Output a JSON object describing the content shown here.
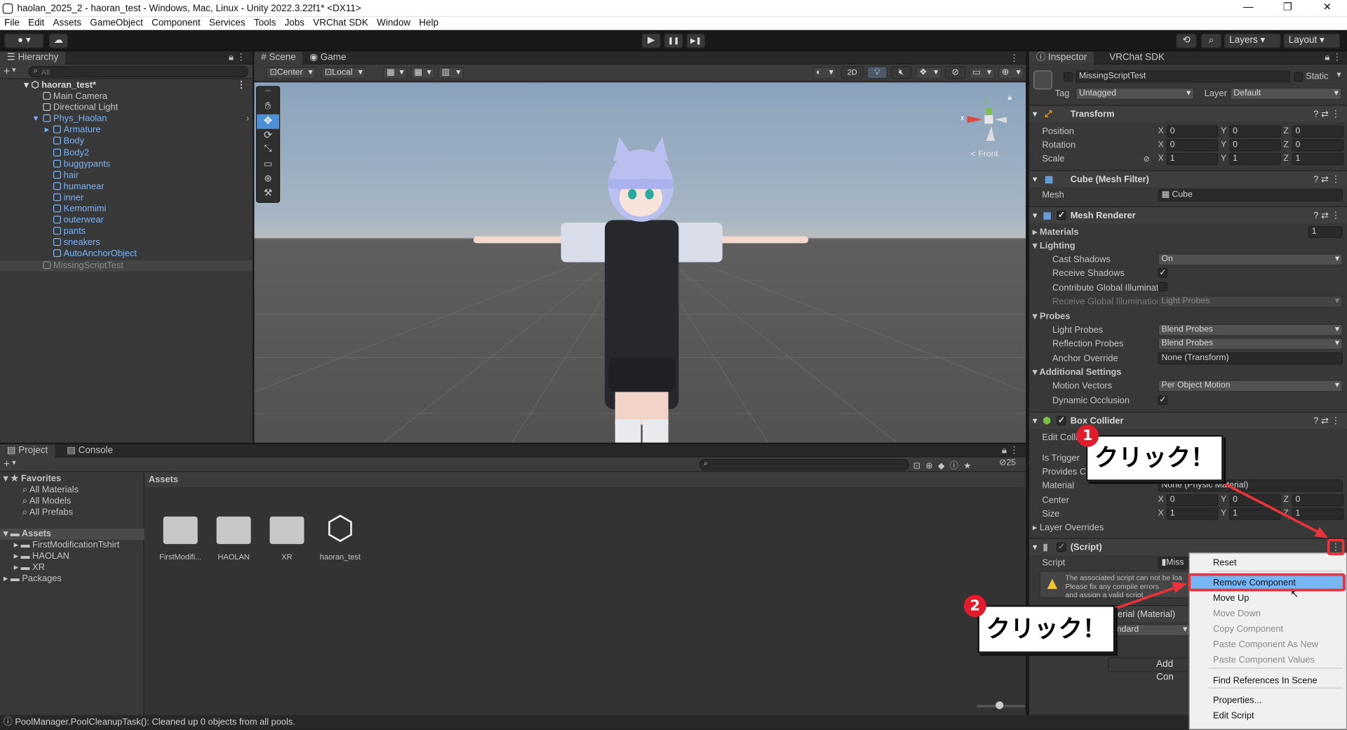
{
  "window": {
    "title": "haolan_2025_2 - haoran_test - Windows, Mac, Linux - Unity 2022.3.22f1* <DX11>",
    "min": "—",
    "max": "❐",
    "close": "✕"
  },
  "menu": [
    "File",
    "Edit",
    "Assets",
    "GameObject",
    "Component",
    "Services",
    "Tools",
    "Jobs",
    "VRChat SDK",
    "Window",
    "Help"
  ],
  "toolbar": {
    "play": "▶",
    "pause": "❚❚",
    "step": "▶❚",
    "layers": "Layers",
    "layout": "Layout"
  },
  "hierarchy": {
    "tab": "Hierarchy",
    "search_placeholder": "All",
    "add": "+",
    "scene": "haoran_test*",
    "items": [
      {
        "label": "Main Camera",
        "depth": 1,
        "color": "#c4c4c4"
      },
      {
        "label": "Directional Light",
        "depth": 1,
        "color": "#c4c4c4"
      },
      {
        "label": "Phys_Haolan",
        "depth": 1,
        "color": "#7cb4f7"
      },
      {
        "label": "Armature",
        "depth": 2,
        "color": "#7cb4f7"
      },
      {
        "label": "Body",
        "depth": 2,
        "color": "#7cb4f7"
      },
      {
        "label": "Body2",
        "depth": 2,
        "color": "#7cb4f7"
      },
      {
        "label": "buggypants",
        "depth": 2,
        "color": "#7cb4f7"
      },
      {
        "label": "hair",
        "depth": 2,
        "color": "#7cb4f7"
      },
      {
        "label": "humanear",
        "depth": 2,
        "color": "#7cb4f7"
      },
      {
        "label": "inner",
        "depth": 2,
        "color": "#7cb4f7"
      },
      {
        "label": "Kemomimi",
        "depth": 2,
        "color": "#7cb4f7"
      },
      {
        "label": "outerwear",
        "depth": 2,
        "color": "#7cb4f7"
      },
      {
        "label": "pants",
        "depth": 2,
        "color": "#7cb4f7"
      },
      {
        "label": "sneakers",
        "depth": 2,
        "color": "#7cb4f7"
      },
      {
        "label": "AutoAnchorObject",
        "depth": 2,
        "color": "#7cb4f7"
      },
      {
        "label": "MissingScriptTest",
        "depth": 1,
        "color": "#8a8a8a"
      }
    ]
  },
  "scene": {
    "tab_scene": "Scene",
    "tab_game": "Game",
    "pivot": "Center",
    "space": "Local",
    "mode2d": "2D",
    "gizmo_label": "< Front",
    "gizmo_x": "x",
    "gizmo_y": "y"
  },
  "inspector": {
    "tab": "Inspector",
    "tab2": "VRChat SDK",
    "object_name": "MissingScriptTest",
    "static": "Static",
    "tag_label": "Tag",
    "tag": "Untagged",
    "layer_label": "Layer",
    "layer": "Default",
    "transform": {
      "title": "Transform",
      "position": "Position",
      "rotation": "Rotation",
      "scale": "Scale",
      "pos": [
        "0",
        "0",
        "0"
      ],
      "rot": [
        "0",
        "0",
        "0"
      ],
      "scl": [
        "1",
        "1",
        "1"
      ]
    },
    "meshfilter": {
      "title": "Cube (Mesh Filter)",
      "mesh_label": "Mesh",
      "mesh": "Cube"
    },
    "meshrenderer": {
      "title": "Mesh Renderer",
      "materials": "Materials",
      "materials_count": "1",
      "lighting": "Lighting",
      "cast_shadows": "Cast Shadows",
      "cast_value": "On",
      "receive_shadows": "Receive Shadows",
      "contribute_gi": "Contribute Global Illuminat",
      "receive_gi": "Receive Global Illuminatior",
      "receive_gi_value": "Light Probes",
      "probes": "Probes",
      "light_probes": "Light Probes",
      "light_probes_value": "Blend Probes",
      "reflection_probes": "Reflection Probes",
      "reflection_value": "Blend Probes",
      "anchor": "Anchor Override",
      "anchor_value": "None (Transform)",
      "additional": "Additional Settings",
      "motion_vectors": "Motion Vectors",
      "motion_value": "Per Object Motion",
      "dynamic_occlusion": "Dynamic Occlusion"
    },
    "boxcollider": {
      "title": "Box Collider",
      "edit": "Edit Colli",
      "is_trigger": "Is Trigger",
      "provides": "Provides C",
      "material": "Material",
      "material_value": "None (Physic Material)",
      "center": "Center",
      "size": "Size",
      "center_v": [
        "0",
        "0",
        "0"
      ],
      "size_v": [
        "1",
        "1",
        "1"
      ],
      "layer_overrides": "Layer Overrides"
    },
    "script": {
      "title": "(Script)",
      "label": "Script",
      "value": "Miss",
      "warn1": "The associated script can not be loa",
      "warn2": "Please fix any compile errors",
      "warn3": "and assign a valid script"
    },
    "material_title": "terial (Material)",
    "shader": "ndard",
    "add_component": "Add Con"
  },
  "project": {
    "tab": "Project",
    "tab2": "Console",
    "add": "+",
    "count": "25",
    "favorites": "Favorites",
    "fav_items": [
      "All Materials",
      "All Models",
      "All Prefabs"
    ],
    "assets": "Assets",
    "asset_folders": [
      "FirstModificationTshirt",
      "HAOLAN",
      "XR"
    ],
    "packages": "Packages",
    "breadcrumb": "Assets",
    "tiles": [
      "FirstModifi...",
      "HAOLAN",
      "XR",
      "haoran_test"
    ]
  },
  "status": "PoolManager.PoolCleanupTask(): Cleaned up 0 objects from all pools.",
  "context_menu": {
    "items": [
      {
        "label": "Reset",
        "enabled": true
      },
      {
        "label": "Remove Component",
        "enabled": true
      },
      {
        "label": "Move Up",
        "enabled": true
      },
      {
        "label": "Move Down",
        "enabled": false
      },
      {
        "label": "Copy Component",
        "enabled": false
      },
      {
        "label": "Paste Component As New",
        "enabled": false
      },
      {
        "label": "Paste Component Values",
        "enabled": false
      },
      {
        "label": "Find References In Scene",
        "enabled": true
      },
      {
        "label": "Properties...",
        "enabled": true
      },
      {
        "label": "Edit Script",
        "enabled": true
      }
    ]
  },
  "annotations": {
    "step1": "1",
    "step2": "2",
    "callout1": "クリック！",
    "callout2": "クリック！"
  },
  "colors": {
    "accent": "#4d8fd6",
    "annotation_red": "#e8333c",
    "highlight": "#77b6f4"
  }
}
